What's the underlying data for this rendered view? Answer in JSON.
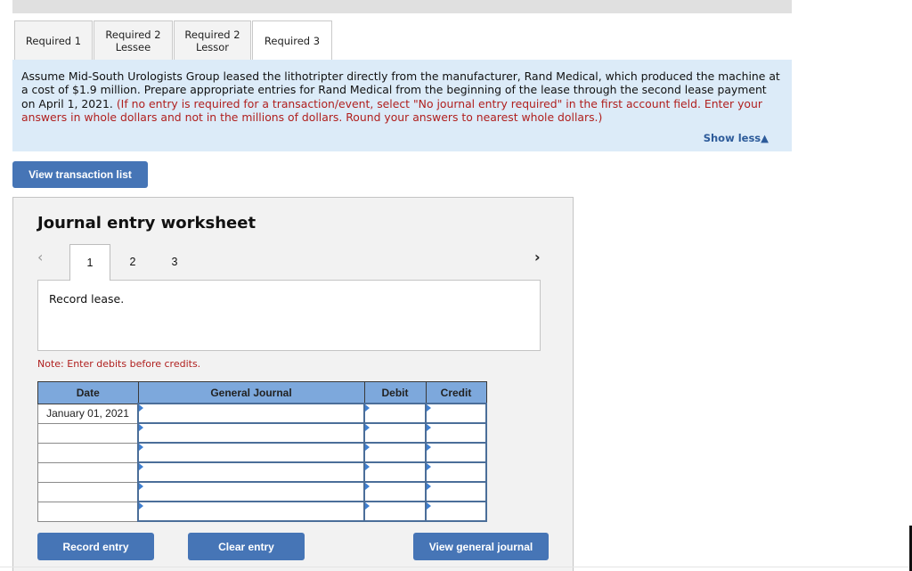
{
  "tabs": [
    {
      "label": "Required 1",
      "active": false
    },
    {
      "label": "Required 2\nLessee",
      "line1": "Required 2",
      "line2": "Lessee",
      "active": false
    },
    {
      "label": "Required 2\nLessor",
      "line1": "Required 2",
      "line2": "Lessor",
      "active": false
    },
    {
      "label": "Required 3",
      "active": true
    }
  ],
  "instructions": {
    "text": "Assume Mid-South Urologists Group leased the lithotripter directly from the manufacturer, Rand Medical, which produced the machine at a cost of $1.9 million. Prepare appropriate entries for Rand Medical from the beginning of the lease through the second lease payment on April 1, 2021.",
    "note": "(If no entry is required for a transaction/event, select \"No journal entry required\" in the first account field. Enter your answers in whole dollars and not in the millions of dollars. Round your answers to nearest whole dollars.)",
    "show_less": "Show less",
    "show_less_icon": "▲"
  },
  "view_transaction_list": "View transaction list",
  "worksheet": {
    "title": "Journal entry worksheet",
    "prev_icon": "‹",
    "next_icon": "›",
    "steps": [
      "1",
      "2",
      "3"
    ],
    "active_step": 1,
    "description": "Record lease.",
    "note": "Note: Enter debits before credits.",
    "columns": {
      "date": "Date",
      "general_journal": "General Journal",
      "debit": "Debit",
      "credit": "Credit"
    },
    "rows": [
      {
        "date": "January 01, 2021",
        "account": "",
        "debit": "",
        "credit": ""
      },
      {
        "date": "",
        "account": "",
        "debit": "",
        "credit": ""
      },
      {
        "date": "",
        "account": "",
        "debit": "",
        "credit": ""
      },
      {
        "date": "",
        "account": "",
        "debit": "",
        "credit": ""
      },
      {
        "date": "",
        "account": "",
        "debit": "",
        "credit": ""
      },
      {
        "date": "",
        "account": "",
        "debit": "",
        "credit": ""
      }
    ],
    "buttons": {
      "record": "Record entry",
      "clear": "Clear entry",
      "view_journal": "View general journal"
    }
  }
}
